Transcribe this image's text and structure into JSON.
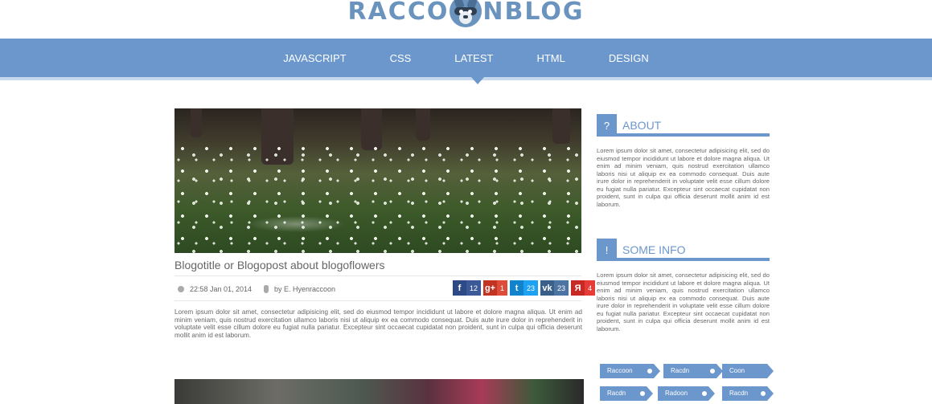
{
  "logo": {
    "left": "RACCO",
    "right": "NBLOG"
  },
  "nav": {
    "items": [
      "JAVASCRIPT",
      "CSS",
      "LATEST",
      "HTML",
      "DESIGN"
    ],
    "active": "LATEST"
  },
  "post": {
    "title": "Blogotitle or Blogopost about blogoflowers",
    "date": "22:58 Jan 01, 2014",
    "author": "by E. Hyenraccoon",
    "shares": {
      "facebook": {
        "icon": "f",
        "count": "12"
      },
      "googleplus": {
        "icon": "g+",
        "count": "1"
      },
      "twitter": {
        "icon": "t",
        "count": "23"
      },
      "vk": {
        "icon": "vk",
        "count": "23"
      },
      "yandex": {
        "icon": "Я",
        "count": "4"
      }
    },
    "excerpt": "Lorem ipsum dolor sit amet, consectetur adipisicing elit, sed do eiusmod tempor incididunt ut labore et dolore magna aliqua. Ut enim ad minim veniam, quis nostrud exercitation ullamco laboris nisi ut aliquip ex ea commodo consequat. Duis aute irure dolor in reprehenderit in voluptate velit esse cillum dolore eu fugiat nulla pariatur. Excepteur sint occaecat cupidatat non proident, sunt in culpa qui officia deserunt mollit anim id est laborum."
  },
  "sidebar": {
    "about": {
      "badge": "?",
      "title": "ABOUT",
      "text": "Lorem ipsum dolor sit amet, consectetur adipisicing elit, sed do eiusmod tempor incididunt ut labore et dolore magna aliqua. Ut enim ad minim veniam, quis nostrud exercitation ullamco laboris nisi ut aliquip ex ea commodo consequat. Duis aute irure dolor in reprehenderit in voluptate velit esse cillum dolore eu fugiat nulla pariatur. Excepteur sint occaecat cupidatat non proident, sunt in culpa qui officia deserunt mollit anim id est laborum."
    },
    "info": {
      "badge": "!",
      "title": "SOME INFO",
      "text": "Lorem ipsum dolor sit amet, consectetur adipisicing elit, sed do eiusmod tempor incididunt ut labore et dolore magna aliqua. Ut enim ad minim veniam, quis nostrud exercitation ullamco laboris nisi ut aliquip ex ea commodo consequat. Duis aute irure dolor in reprehenderit in voluptate velit esse cillum dolore eu fugiat nulla pariatur. Excepteur sint occaecat cupidatat non proident, sunt in culpa qui officia deserunt mollit anim id est laborum."
    },
    "tags": [
      "Raccoon",
      "Racdn",
      "Coon",
      "Racdn",
      "Radoon",
      "Racdn"
    ]
  },
  "colors": {
    "accent": "#6b97cc",
    "accent_light": "#c7d9ee"
  }
}
